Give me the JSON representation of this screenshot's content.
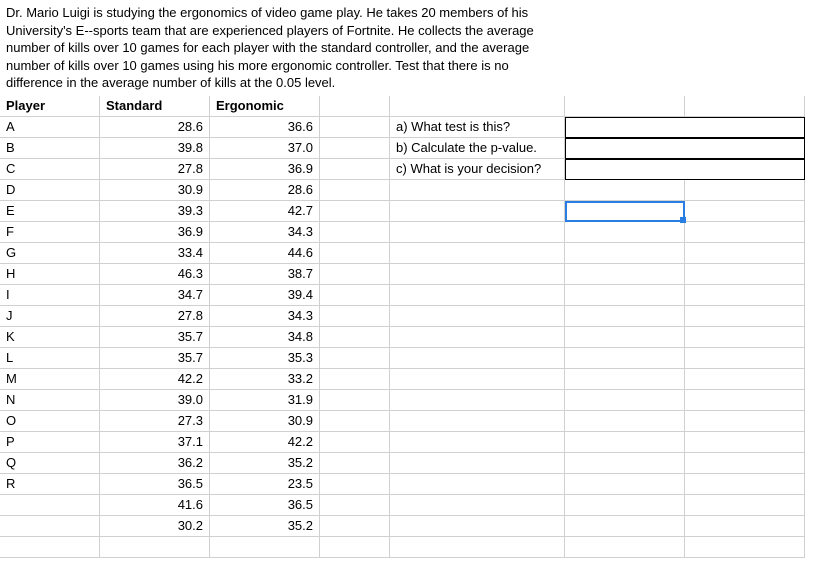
{
  "problem": "Dr. Mario Luigi is studying the ergonomics of video game play. He takes 20 members of his University's E--sports team that are experienced players of Fortnite. He collects the average number of kills over 10 games for each player with the standard controller, and the average number of kills over 10 games using his more ergonomic controller. Test that there is no difference in the average number of kills at the 0.05 level.",
  "headers": {
    "player": "Player",
    "standard": "Standard",
    "ergonomic": "Ergonomic"
  },
  "rows": [
    {
      "player": "A",
      "standard": "28.6",
      "ergonomic": "36.6"
    },
    {
      "player": "B",
      "standard": "39.8",
      "ergonomic": "37.0"
    },
    {
      "player": "C",
      "standard": "27.8",
      "ergonomic": "36.9"
    },
    {
      "player": "D",
      "standard": "30.9",
      "ergonomic": "28.6"
    },
    {
      "player": "E",
      "standard": "39.3",
      "ergonomic": "42.7"
    },
    {
      "player": "F",
      "standard": "36.9",
      "ergonomic": "34.3"
    },
    {
      "player": "G",
      "standard": "33.4",
      "ergonomic": "44.6"
    },
    {
      "player": "H",
      "standard": "46.3",
      "ergonomic": "38.7"
    },
    {
      "player": "I",
      "standard": "34.7",
      "ergonomic": "39.4"
    },
    {
      "player": "J",
      "standard": "27.8",
      "ergonomic": "34.3"
    },
    {
      "player": "K",
      "standard": "35.7",
      "ergonomic": "34.8"
    },
    {
      "player": "L",
      "standard": "35.7",
      "ergonomic": "35.3"
    },
    {
      "player": "M",
      "standard": "42.2",
      "ergonomic": "33.2"
    },
    {
      "player": "N",
      "standard": "39.0",
      "ergonomic": "31.9"
    },
    {
      "player": "O",
      "standard": "27.3",
      "ergonomic": "30.9"
    },
    {
      "player": "P",
      "standard": "37.1",
      "ergonomic": "42.2"
    },
    {
      "player": "Q",
      "standard": "36.2",
      "ergonomic": "35.2"
    },
    {
      "player": "R",
      "standard": "36.5",
      "ergonomic": "23.5"
    },
    {
      "player": "",
      "standard": "41.6",
      "ergonomic": "36.5"
    },
    {
      "player": "",
      "standard": "30.2",
      "ergonomic": "35.2"
    }
  ],
  "questions": {
    "a": "a) What test is this?",
    "b": "b) Calculate the p-value.",
    "c": "c) What is your decision?"
  },
  "chart_data": {
    "type": "table",
    "title": "Paired controller kill averages",
    "columns": [
      "Player",
      "Standard",
      "Ergonomic"
    ],
    "data": [
      [
        "A",
        28.6,
        36.6
      ],
      [
        "B",
        39.8,
        37.0
      ],
      [
        "C",
        27.8,
        36.9
      ],
      [
        "D",
        30.9,
        28.6
      ],
      [
        "E",
        39.3,
        42.7
      ],
      [
        "F",
        36.9,
        34.3
      ],
      [
        "G",
        33.4,
        44.6
      ],
      [
        "H",
        46.3,
        38.7
      ],
      [
        "I",
        34.7,
        39.4
      ],
      [
        "J",
        27.8,
        34.3
      ],
      [
        "K",
        35.7,
        34.8
      ],
      [
        "L",
        35.7,
        35.3
      ],
      [
        "M",
        42.2,
        33.2
      ],
      [
        "N",
        39.0,
        31.9
      ],
      [
        "O",
        27.3,
        30.9
      ],
      [
        "P",
        37.1,
        42.2
      ],
      [
        "Q",
        36.2,
        35.2
      ],
      [
        "R",
        36.5,
        23.5
      ],
      [
        "",
        41.6,
        36.5
      ],
      [
        "",
        30.2,
        35.2
      ]
    ],
    "alpha": 0.05
  }
}
